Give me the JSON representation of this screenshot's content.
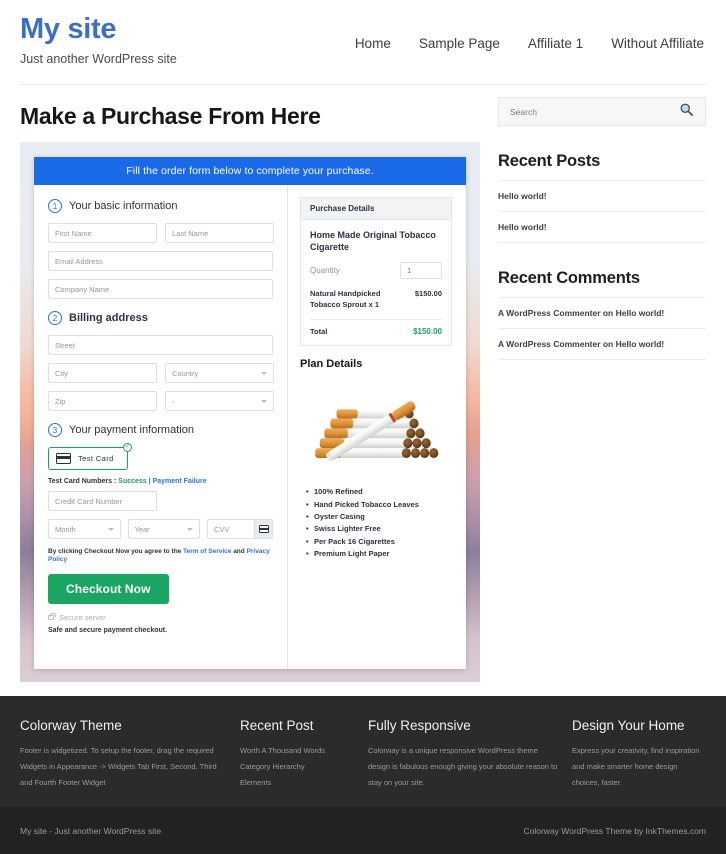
{
  "header": {
    "site_title": "My site",
    "tagline": "Just another WordPress site",
    "nav": [
      {
        "label": "Home"
      },
      {
        "label": "Sample Page"
      },
      {
        "label": "Affiliate 1"
      },
      {
        "label": "Without Affiliate"
      }
    ]
  },
  "main": {
    "page_title": "Make a Purchase From Here",
    "form": {
      "banner": "Fill the order form below to complete your purchase.",
      "step1": {
        "num": "1",
        "label": "Your basic information",
        "first_name": "First Name",
        "last_name": "Last Name",
        "email": "Email Address",
        "company": "Company Name"
      },
      "step2": {
        "num": "2",
        "label": "Billing address",
        "street": "Street",
        "city": "City",
        "country": "Country",
        "zip": "Zip",
        "state": "-"
      },
      "step3": {
        "num": "3",
        "label": "Your payment information",
        "test_card_label": "Test  Card",
        "check_glyph": "✓",
        "test_numbers_prefix": "Test Card Numbers : ",
        "test_success": "Success",
        "test_separator": " | ",
        "test_failure": "Payment Failure",
        "card_number": "Credit Card Number",
        "month": "Month",
        "year": "Year",
        "cvv": "CVV",
        "terms_prefix": "By clicking Checkout Now you agree to the ",
        "terms_link": "Term of Service",
        "terms_mid": " and ",
        "privacy_link": "Privacy Policy",
        "checkout_button": "Checkout Now",
        "secure_server": "Secure server",
        "safe_note": "Safe and secure payment checkout."
      }
    },
    "purchase_details": {
      "heading": "Purchase Details",
      "product": "Home Made Original Tobacco Cigarette",
      "quantity_label": "Quantity",
      "quantity_value": "1",
      "line_item": "Natural Handpicked Tobacco Sprout x 1",
      "line_amount": "$150.00",
      "total_label": "Total",
      "total_amount": "$150.00"
    },
    "plan": {
      "title": "Plan Details",
      "features": [
        "100% Refined",
        "Hand Picked Tobacco Leaves",
        "Oyster Casing",
        "Swiss Lighter Free",
        "Per Pack 16 Cigarettes",
        "Premium Light Paper"
      ]
    }
  },
  "sidebar": {
    "search_placeholder": "Search",
    "recent_posts": {
      "heading": "Recent Posts",
      "items": [
        {
          "label": "Hello world!"
        },
        {
          "label": "Hello world!"
        }
      ]
    },
    "recent_comments": {
      "heading": "Recent Comments",
      "items": [
        {
          "label": "A WordPress Commenter on Hello world!"
        },
        {
          "label": "A WordPress Commenter on Hello world!"
        }
      ]
    }
  },
  "footer": {
    "widgets": [
      {
        "title": "Colorway Theme",
        "text": "Footer is widgetized. To setup the footer, drag the required Widgets in Appearance -> Widgets Tab First, Second, Third and Fourth Footer Widget"
      },
      {
        "title": "Recent Post",
        "links": [
          {
            "label": "Worth A Thousand Words"
          },
          {
            "label": "Category Hierarchy"
          },
          {
            "label": "Elements"
          }
        ]
      },
      {
        "title": "Fully Responsive",
        "text": "Colorway is a unique responsive WordPress theme design is fabulous enough giving your absolute reason to stay on your site."
      },
      {
        "title": "Design Your Home",
        "text": "Express your creativity, find inspiration and make smarter home design choices, faster."
      }
    ],
    "bar_left": "My site - Just another WordPress site",
    "bar_right": "Colorway WordPress Theme by InkThemes.com"
  },
  "colors": {
    "brand_blue": "#3b6fc4",
    "banner_blue": "#1a6ae8",
    "accent_green": "#1aa563",
    "link_blue": "#2f6fdd",
    "footer_dark": "#2b2b2b"
  }
}
